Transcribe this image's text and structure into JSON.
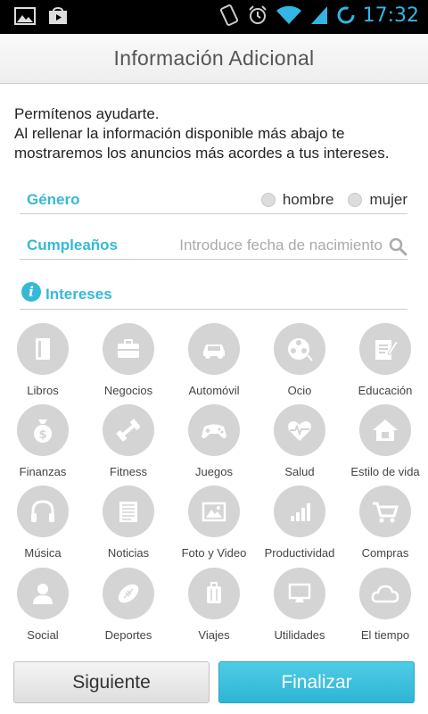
{
  "status_bar": {
    "time": "17:32"
  },
  "header": {
    "title": "Información Adicional"
  },
  "intro": {
    "line1": "Permítenos ayudarte.",
    "line2": "Al rellenar la información disponible más abajo te mostraremos los anuncios más acordes a tus intereses."
  },
  "gender": {
    "label": "Género",
    "options": [
      "hombre",
      "mujer"
    ]
  },
  "birthday": {
    "label": "Cumpleaños",
    "placeholder": "Introduce fecha de nacimiento"
  },
  "interests": {
    "label": "Intereses",
    "items": [
      {
        "label": "Libros",
        "icon": "book-icon"
      },
      {
        "label": "Negocios",
        "icon": "briefcase-icon"
      },
      {
        "label": "Automóvil",
        "icon": "car-icon"
      },
      {
        "label": "Ocio",
        "icon": "film-reel-icon"
      },
      {
        "label": "Educación",
        "icon": "pencil-paper-icon"
      },
      {
        "label": "Finanzas",
        "icon": "money-bag-icon"
      },
      {
        "label": "Fitness",
        "icon": "dumbbell-icon"
      },
      {
        "label": "Juegos",
        "icon": "gamepad-icon"
      },
      {
        "label": "Salud",
        "icon": "heart-pulse-icon"
      },
      {
        "label": "Estilo de vida",
        "icon": "house-icon"
      },
      {
        "label": "Música",
        "icon": "headphones-icon"
      },
      {
        "label": "Noticias",
        "icon": "newspaper-icon"
      },
      {
        "label": "Foto y Video",
        "icon": "photo-icon"
      },
      {
        "label": "Productividad",
        "icon": "bar-chart-icon"
      },
      {
        "label": "Compras",
        "icon": "shopping-cart-icon"
      },
      {
        "label": "Social",
        "icon": "person-icon"
      },
      {
        "label": "Deportes",
        "icon": "football-icon"
      },
      {
        "label": "Viajes",
        "icon": "suitcase-icon"
      },
      {
        "label": "Utilidades",
        "icon": "monitor-icon"
      },
      {
        "label": "El tiempo",
        "icon": "cloud-icon"
      }
    ]
  },
  "buttons": {
    "next": "Siguiente",
    "finish": "Finalizar"
  },
  "colors": {
    "accent": "#36b9d6",
    "finish_button": "#33b5e5",
    "icon_circle": "#d4d4d4",
    "status_time": "#33b5e5"
  }
}
